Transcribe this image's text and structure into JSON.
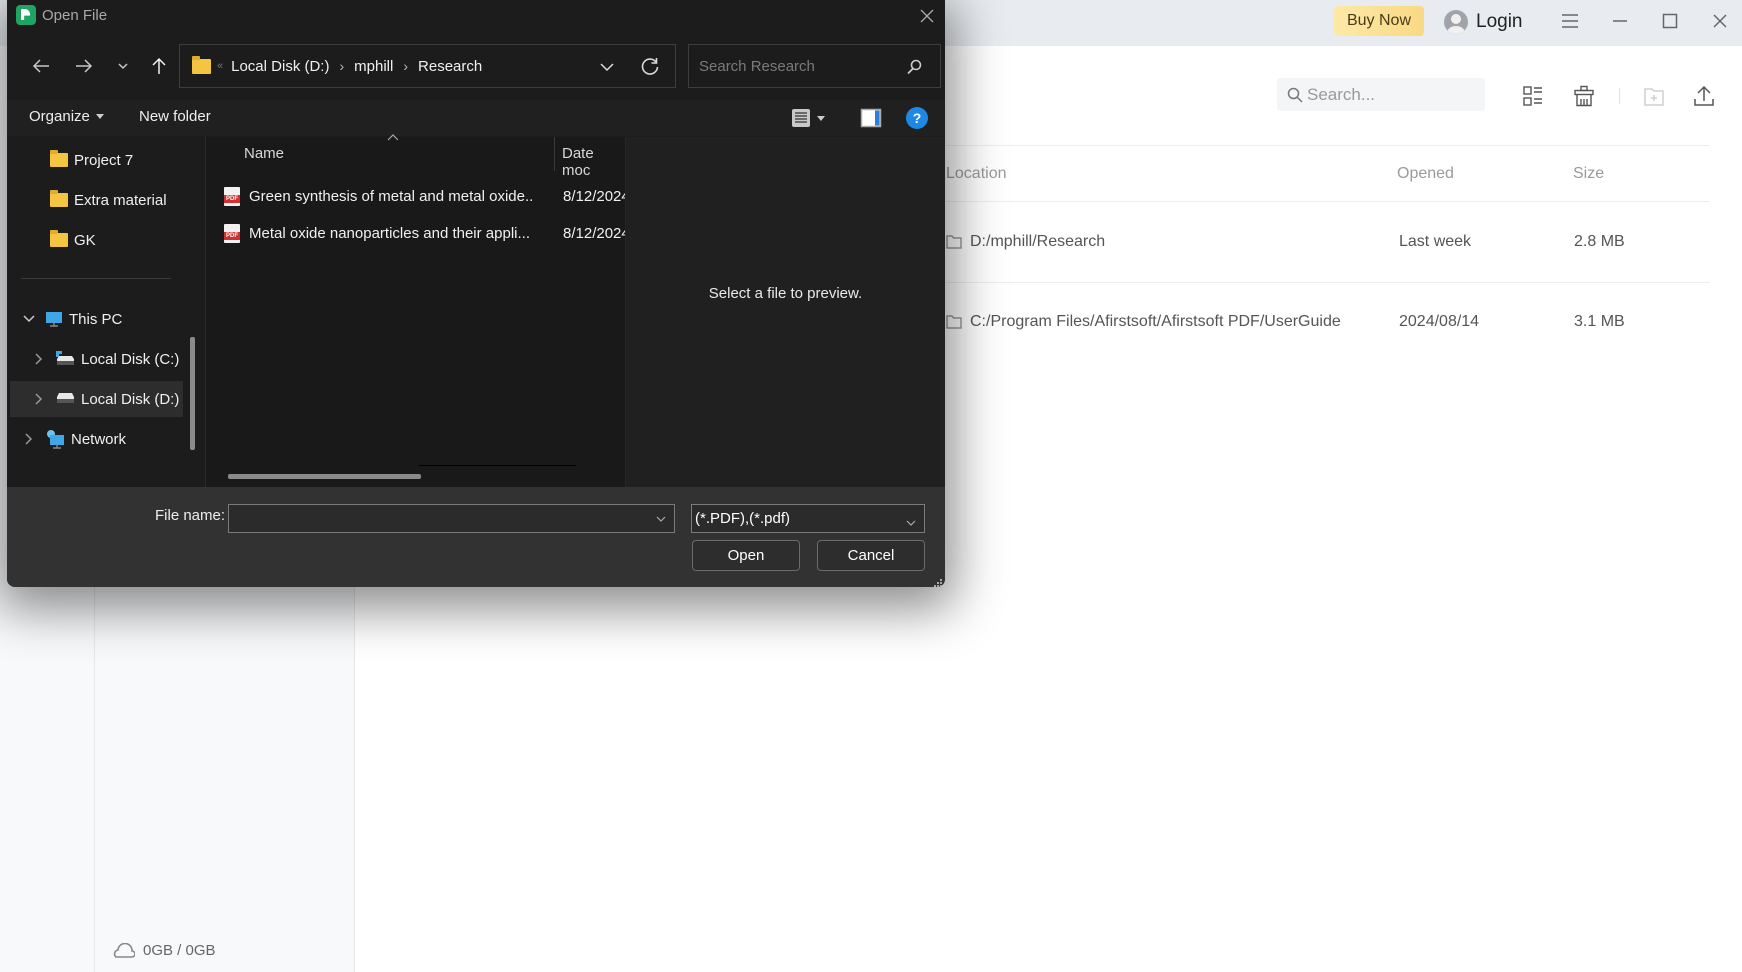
{
  "background_app": {
    "topbar": {
      "buy_now_label": "Buy Now",
      "login_label": "Login"
    },
    "toolbar": {
      "search_placeholder": "Search..."
    },
    "table": {
      "columns": [
        "Location",
        "Opened",
        "Size"
      ],
      "rows": [
        {
          "location": "D:/mphill/Research",
          "opened": "Last week",
          "size": "2.8 MB"
        },
        {
          "location": "C:/Program Files/Afirstsoft/Afirstsoft PDF/UserGuide",
          "opened": "2024/08/14",
          "size": "3.1 MB"
        }
      ]
    },
    "storage_label": "0GB / 0GB"
  },
  "dialog": {
    "title": "Open File",
    "address": {
      "overflow_marker": "«",
      "crumbs": [
        "Local Disk (D:)",
        "mphill",
        "Research"
      ],
      "separator": "›"
    },
    "search_placeholder": "Search Research",
    "toolbar": {
      "organize_label": "Organize",
      "new_folder_label": "New folder",
      "help_label": "?"
    },
    "nav_pane": {
      "quick_items": [
        "Project 7",
        "Extra material",
        "GK"
      ],
      "this_pc_label": "This PC",
      "drives": [
        "Local Disk (C:)",
        "Local Disk (D:)"
      ],
      "selected_drive": "Local Disk (D:)",
      "network_label": "Network"
    },
    "file_list": {
      "columns": {
        "name": "Name",
        "date": "Date moc"
      },
      "files": [
        {
          "name": "Green synthesis of metal and metal oxide...",
          "date": "8/12/2024"
        },
        {
          "name": "Metal oxide nanoparticles and their appli...",
          "date": "8/12/2024"
        }
      ]
    },
    "preview_message": "Select a file to preview.",
    "bottom": {
      "file_name_label": "File name:",
      "file_name_value": "",
      "file_type_value": "(*.PDF),(*.pdf)",
      "open_label": "Open",
      "cancel_label": "Cancel"
    }
  },
  "colors": {
    "dialog_bg": "#1c1c1c",
    "dialog_bottom_bg": "#323232",
    "help_blue": "#1e88e5",
    "folder_yellow": "#f5c542",
    "pdf_red": "#d32f2f",
    "buy_now_gold": "#f9d983",
    "app_topbar": "#e8ecf0"
  }
}
